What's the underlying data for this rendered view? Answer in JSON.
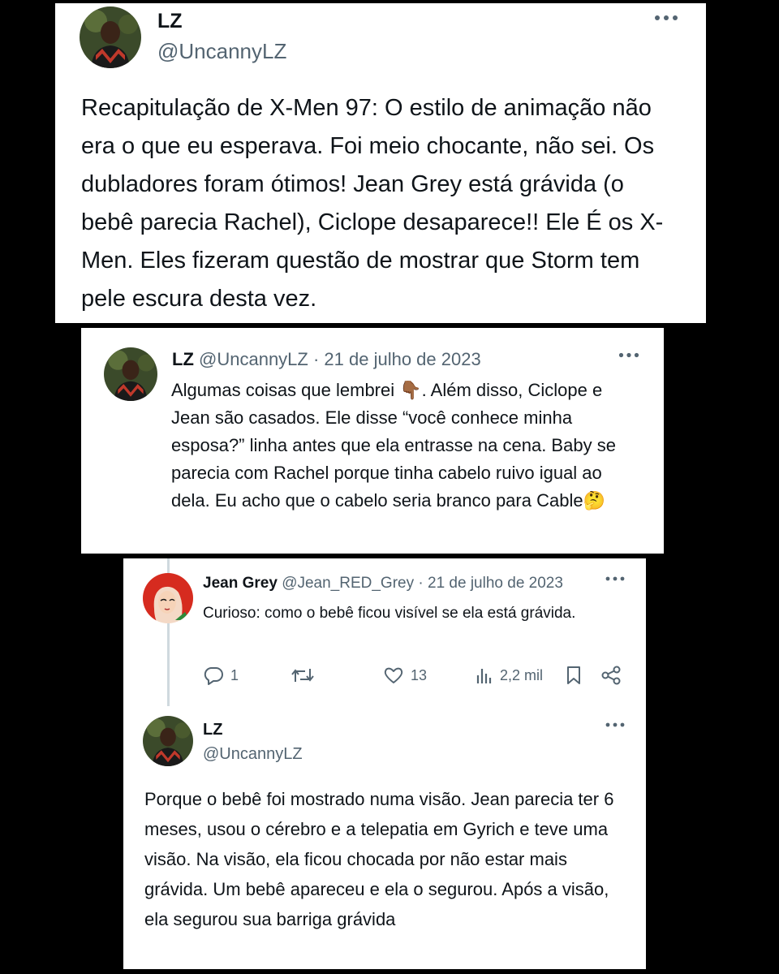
{
  "tweet1": {
    "name": "LZ",
    "handle": "@UncannyLZ",
    "text": "Recapitulação de X-Men 97: O estilo de animação não era o que eu esperava. Foi meio chocante, não sei. Os dubladores foram ótimos! Jean Grey está grávida (o bebê parecia Rachel), Ciclope desaparece!! Ele É os X-Men. Eles fizeram questão de mostrar que Storm tem pele escura desta vez."
  },
  "tweet2": {
    "name": "LZ",
    "handle": "@UncannyLZ",
    "separator": " · ",
    "date": "21 de julho de 2023",
    "text_part1": "Algumas coisas que lembrei ",
    "emoji_point": "👇🏾",
    "text_part2": ". Além disso, Ciclope e Jean são casados. Ele disse “você conhece minha esposa?” linha antes que ela entrasse na cena. Baby se parecia com Rachel porque tinha cabelo ruivo igual ao dela. Eu acho que o cabelo seria branco para Cable",
    "emoji_think": "🤔"
  },
  "reply_jean": {
    "name": "Jean Grey",
    "handle": "@Jean_RED_Grey",
    "separator": " · ",
    "date": "21 de julho de 2023",
    "text": "Curioso: como o bebê ficou visível se ela está grávida.",
    "actions": {
      "replies": "1",
      "retweets": "",
      "likes": "13",
      "views": "2,2 mil"
    }
  },
  "reply_lz": {
    "name": "LZ",
    "handle": "@UncannyLZ",
    "text": "Porque o bebê foi mostrado numa visão. Jean parecia ter 6 meses, usou o cérebro e a telepatia em Gyrich e teve uma visão. Na visão, ela ficou chocada por não estar mais grávida. Um bebê apareceu e ela o segurou. Após a visão, ela segurou sua barriga grávida"
  },
  "icons": {
    "more": "more-horizontal-icon",
    "reply": "reply-bubble-icon",
    "retweet": "retweet-icon",
    "like": "heart-icon",
    "views": "views-bar-chart-icon",
    "bookmark": "bookmark-icon",
    "share": "share-icon"
  },
  "colors": {
    "text": "#0f1419",
    "secondary": "#536471",
    "thread_line": "#cfd9de"
  }
}
